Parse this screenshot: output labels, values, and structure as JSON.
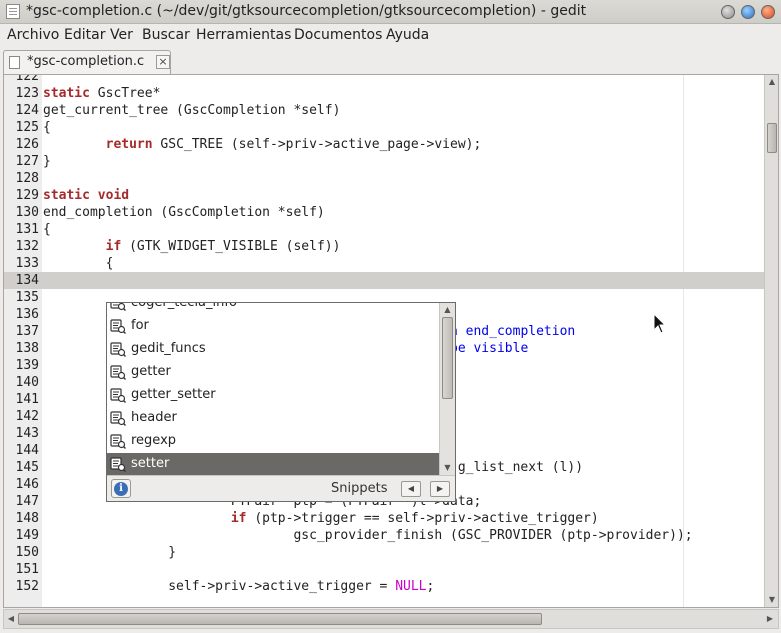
{
  "window": {
    "title": "*gsc-completion.c (~/dev/git/gtksourcecompletion/gtksourcecompletion) - gedit"
  },
  "menu": [
    "Archivo",
    "Editar",
    "Ver",
    "Buscar",
    "Herramientas",
    "Documentos",
    "Ayuda"
  ],
  "tab": {
    "label": "*gsc-completion.c",
    "close": "×"
  },
  "code_lines": [
    {
      "n": "122",
      "segs": []
    },
    {
      "n": "123",
      "segs": [
        {
          "t": "static ",
          "c": "kw"
        },
        {
          "t": "GscTree*"
        }
      ]
    },
    {
      "n": "124",
      "segs": [
        {
          "t": "get_current_tree (GscCompletion *self)"
        }
      ]
    },
    {
      "n": "125",
      "segs": [
        {
          "t": "{"
        }
      ]
    },
    {
      "n": "126",
      "segs": [
        {
          "t": "        "
        },
        {
          "t": "return",
          "c": "kw"
        },
        {
          "t": " GSC_TREE (self->priv->active_page->view);"
        }
      ]
    },
    {
      "n": "127",
      "segs": [
        {
          "t": "}"
        }
      ]
    },
    {
      "n": "128",
      "segs": []
    },
    {
      "n": "129",
      "segs": [
        {
          "t": "static void",
          "c": "kw"
        }
      ]
    },
    {
      "n": "130",
      "segs": [
        {
          "t": "end_completion (GscCompletion *self)"
        }
      ]
    },
    {
      "n": "131",
      "segs": [
        {
          "t": "{"
        }
      ]
    },
    {
      "n": "132",
      "segs": [
        {
          "t": "        "
        },
        {
          "t": "if",
          "c": "kw"
        },
        {
          "t": " (GTK_WIDGET_VISIBLE (self))"
        }
      ]
    },
    {
      "n": "133",
      "segs": [
        {
          "t": "        {"
        }
      ]
    },
    {
      "n": "134",
      "segs": [],
      "current": true
    },
    {
      "n": "135",
      "segs": []
    },
    {
      "n": "136",
      "segs": []
    },
    {
      "n": "137",
      "segs": [
        {
          "t": "                                         "
        },
        {
          "t": "al too. Then end_completion",
          "c": "cmt"
        }
      ]
    },
    {
      "n": "138",
      "segs": [
        {
          "t": "                                         "
        },
        {
          "t": "o will not be visible",
          "c": "cmt"
        }
      ]
    },
    {
      "n": "139",
      "segs": []
    },
    {
      "n": "140",
      "segs": []
    },
    {
      "n": "141",
      "segs": []
    },
    {
      "n": "142",
      "segs": []
    },
    {
      "n": "143",
      "segs": []
    },
    {
      "n": "144",
      "segs": []
    },
    {
      "n": "145",
      "segs": [
        {
          "t": "                                         = "
        },
        {
          "t": "NULL",
          "c": "null"
        },
        {
          "t": "; l = g_list_next (l))"
        }
      ]
    },
    {
      "n": "146",
      "segs": [
        {
          "t": "                {"
        }
      ]
    },
    {
      "n": "147",
      "segs": [
        {
          "t": "                        PTPair *ptp = (PTPair *)l->data;"
        }
      ]
    },
    {
      "n": "148",
      "segs": [
        {
          "t": "                        "
        },
        {
          "t": "if",
          "c": "kw"
        },
        {
          "t": " (ptp->trigger == self->priv->active_trigger)"
        }
      ]
    },
    {
      "n": "149",
      "segs": [
        {
          "t": "                                gsc_provider_finish (GSC_PROVIDER (ptp->provider));"
        }
      ]
    },
    {
      "n": "150",
      "segs": [
        {
          "t": "                }"
        }
      ]
    },
    {
      "n": "151",
      "segs": []
    },
    {
      "n": "152",
      "segs": [
        {
          "t": "                self->priv->active_trigger = "
        },
        {
          "t": "NULL",
          "c": "null"
        },
        {
          "t": ";"
        }
      ]
    }
  ],
  "completion": {
    "items": [
      "coger_tecla_info",
      "for",
      "gedit_funcs",
      "getter",
      "getter_setter",
      "header",
      "regexp",
      "setter"
    ],
    "selected_index": 7,
    "provider": "Snippets",
    "prev": "◀",
    "next": "▶",
    "info_glyph": "i"
  },
  "colors": {
    "keyword": "#a52a2a",
    "null": "#cc00cc",
    "comment": "#0000ee",
    "selection": "#6a6966",
    "current_line": "#d0cfcc"
  },
  "icons": {
    "snippet_icon": "snippet-icon",
    "info_icon": "info-icon"
  }
}
